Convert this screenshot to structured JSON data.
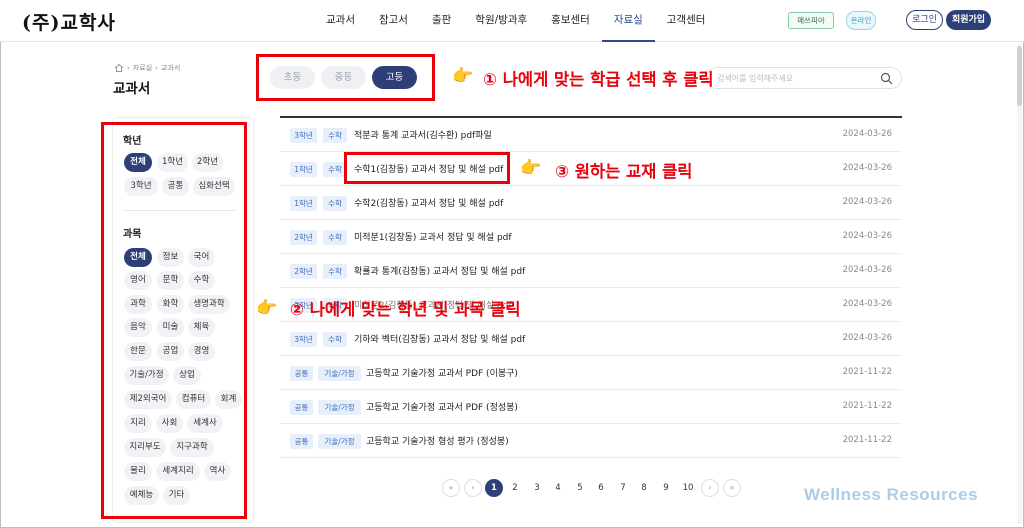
{
  "header": {
    "logo": "(주)교학사",
    "nav": [
      "교과서",
      "참고서",
      "출판",
      "학원/방과후",
      "홍보센터",
      "자료실",
      "고객센터"
    ],
    "active_nav": "자료실",
    "badge1": "매쓰피아",
    "badge2": "온라인",
    "login": "로그인",
    "join": "회원가입"
  },
  "breadcrumb": [
    "자료실",
    "교과서"
  ],
  "page_title": "교과서",
  "levels": [
    "초등",
    "중등",
    "고등"
  ],
  "active_level": "고등",
  "search": {
    "placeholder": "검색어를 입력해주세요"
  },
  "annotations": {
    "step1": "① 나에게 맞는 학급 선택 후 클릭",
    "step2": "② 나에게 맞는 학년 및 과목 클릭",
    "step3": "③ 원하는 교재 클릭"
  },
  "sidebar": {
    "grade_heading": "학년",
    "grades": [
      "전체",
      "1학년",
      "2학년",
      "3학년",
      "공통",
      "심화선택"
    ],
    "subject_heading": "과목",
    "subjects": [
      "전체",
      "정보",
      "국어",
      "영어",
      "문학",
      "수학",
      "과학",
      "화학",
      "생명과학",
      "음악",
      "미술",
      "체육",
      "한문",
      "공업",
      "경영",
      "기술/가정",
      "상업",
      "제2외국어",
      "컴퓨터",
      "회계",
      "지리",
      "사회",
      "세계사",
      "지리부도",
      "지구과학",
      "물리",
      "세계지리",
      "역사",
      "예체능",
      "기타"
    ]
  },
  "items": [
    {
      "grade": "3학년",
      "subject": "수학",
      "title": "적분과 통계 교과서(김수환) pdf파일",
      "date": "2024-03-26"
    },
    {
      "grade": "1학년",
      "subject": "수학",
      "title": "수학1(김창동) 교과서 정답 및 해설 pdf",
      "date": "2024-03-26"
    },
    {
      "grade": "1학년",
      "subject": "수학",
      "title": "수학2(김창동) 교과서 정답 및 해설 pdf",
      "date": "2024-03-26"
    },
    {
      "grade": "2학년",
      "subject": "수학",
      "title": "미적분1(김창동) 교과서 정답 및 해설 pdf",
      "date": "2024-03-26"
    },
    {
      "grade": "2학년",
      "subject": "수학",
      "title": "확률과 통계(김창동) 교과서 정답 및 해설 pdf",
      "date": "2024-03-26"
    },
    {
      "grade": "2학년",
      "subject": "수학",
      "title": "미적분2(김창동) 교과서 정답 및 해설 pdf",
      "date": "2024-03-26"
    },
    {
      "grade": "3학년",
      "subject": "수학",
      "title": "기하와 벡터(김창동) 교과서 정답 및 해설 pdf",
      "date": "2024-03-26"
    },
    {
      "grade": "공통",
      "subject": "기술/가정",
      "title": "고등학교 기술가정 교과서 PDF (이봉구)",
      "date": "2021-11-22"
    },
    {
      "grade": "공통",
      "subject": "기술/가정",
      "title": "고등학교 기술가정 교과서 PDF (정성봉)",
      "date": "2021-11-22"
    },
    {
      "grade": "공통",
      "subject": "기술/가정",
      "title": "고등학교 기술가정 형성 평가 (정성봉)",
      "date": "2021-11-22"
    }
  ],
  "pagination": {
    "first": "«",
    "prev": "‹",
    "pages": [
      "1",
      "2",
      "3",
      "4",
      "5",
      "6",
      "7",
      "8",
      "9",
      "10"
    ],
    "active": "1",
    "next": "›",
    "last": "»"
  },
  "watermark": "Wellness Resources"
}
